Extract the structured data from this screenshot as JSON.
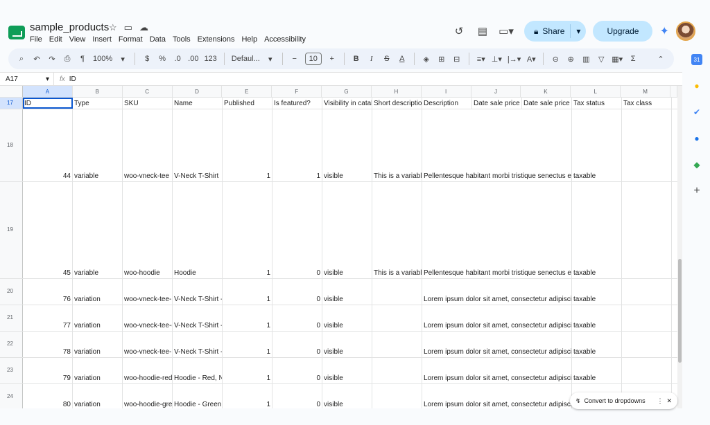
{
  "doc": {
    "title": "sample_products"
  },
  "menu": [
    "File",
    "Edit",
    "View",
    "Insert",
    "Format",
    "Data",
    "Tools",
    "Extensions",
    "Help",
    "Accessibility"
  ],
  "header": {
    "share_label": "Share",
    "upgrade_label": "Upgrade"
  },
  "toolbar": {
    "zoom": "100%",
    "currency": "$",
    "percent": "%",
    "dec_dec": ".0",
    "dec_inc": ".00",
    "num_format": "123",
    "font": "Defaul...",
    "font_size": "10",
    "bold": "B",
    "italic": "I",
    "sigma": "Σ"
  },
  "formula": {
    "cell_ref": "A17",
    "content": "ID"
  },
  "columns": [
    "A",
    "B",
    "C",
    "D",
    "E",
    "F",
    "G",
    "H",
    "I",
    "J",
    "K",
    "L",
    "M"
  ],
  "rows": [
    {
      "num": "17",
      "cells": [
        "ID",
        "Type",
        "SKU",
        "Name",
        "Published",
        "Is featured?",
        "Visibility in catalog",
        "Short description",
        "Description",
        "Date sale price s",
        "Date sale price e",
        "Tax status",
        "Tax class"
      ]
    },
    {
      "num": "18",
      "cells": [
        "44",
        "variable",
        "woo-vneck-tee",
        "V-Neck T-Shirt",
        "1",
        "1",
        "visible",
        "This is a variable",
        "Pellentesque habitant morbi tristique senectus et n",
        "",
        "",
        "taxable",
        ""
      ]
    },
    {
      "num": "19",
      "cells": [
        "45",
        "variable",
        "woo-hoodie",
        "Hoodie",
        "1",
        "0",
        "visible",
        "This is a variable",
        "Pellentesque habitant morbi tristique senectus et n",
        "",
        "",
        "taxable",
        ""
      ]
    },
    {
      "num": "20",
      "cells": [
        "76",
        "variation",
        "woo-vneck-tee-r",
        "V-Neck T-Shirt -",
        "1",
        "0",
        "visible",
        "",
        "Lorem ipsum dolor sit amet, consectetur adipiscing",
        "",
        "",
        "taxable",
        ""
      ]
    },
    {
      "num": "21",
      "cells": [
        "77",
        "variation",
        "woo-vneck-tee-g",
        "V-Neck T-Shirt -",
        "1",
        "0",
        "visible",
        "",
        "Lorem ipsum dolor sit amet, consectetur adipiscing",
        "",
        "",
        "taxable",
        ""
      ]
    },
    {
      "num": "22",
      "cells": [
        "78",
        "variation",
        "woo-vneck-tee-b",
        "V-Neck T-Shirt -",
        "1",
        "0",
        "visible",
        "",
        "Lorem ipsum dolor sit amet, consectetur adipiscing",
        "",
        "",
        "taxable",
        ""
      ]
    },
    {
      "num": "23",
      "cells": [
        "79",
        "variation",
        "woo-hoodie-red",
        "Hoodie - Red, N",
        "1",
        "0",
        "visible",
        "",
        "Lorem ipsum dolor sit amet, consectetur adipiscing",
        "",
        "",
        "taxable",
        ""
      ]
    },
    {
      "num": "24",
      "cells": [
        "80",
        "variation",
        "woo-hoodie-gree",
        "Hoodie - Green,",
        "1",
        "0",
        "visible",
        "",
        "Lorem ipsum dolor sit amet, consectetur adipiscing",
        "",
        "",
        "",
        ""
      ]
    }
  ],
  "toast": {
    "label": "Convert to dropdowns"
  },
  "colors": {
    "accent": "#0b57d0",
    "share_bg": "#c2e7ff",
    "sheets_green": "#0f9d58"
  }
}
